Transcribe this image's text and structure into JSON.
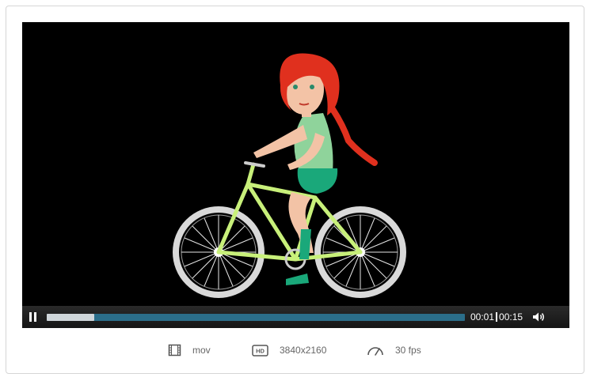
{
  "player": {
    "state": "playing",
    "progress_fraction": 0.113,
    "current_time": "00:01",
    "duration": "00:15"
  },
  "meta": {
    "format": "mov",
    "resolution": "3840x2160",
    "fps": "30 fps"
  },
  "icons": [
    "pause-icon",
    "volume-icon",
    "film-icon",
    "hd-icon",
    "gauge-icon"
  ],
  "colors": {
    "player_bg": "#000000",
    "progress_track": "#2b6e8a",
    "progress_played": "#cfd6da",
    "hair": "#e0301e",
    "bike_frame": "#c8f07a",
    "shorts": "#1aa87a"
  }
}
